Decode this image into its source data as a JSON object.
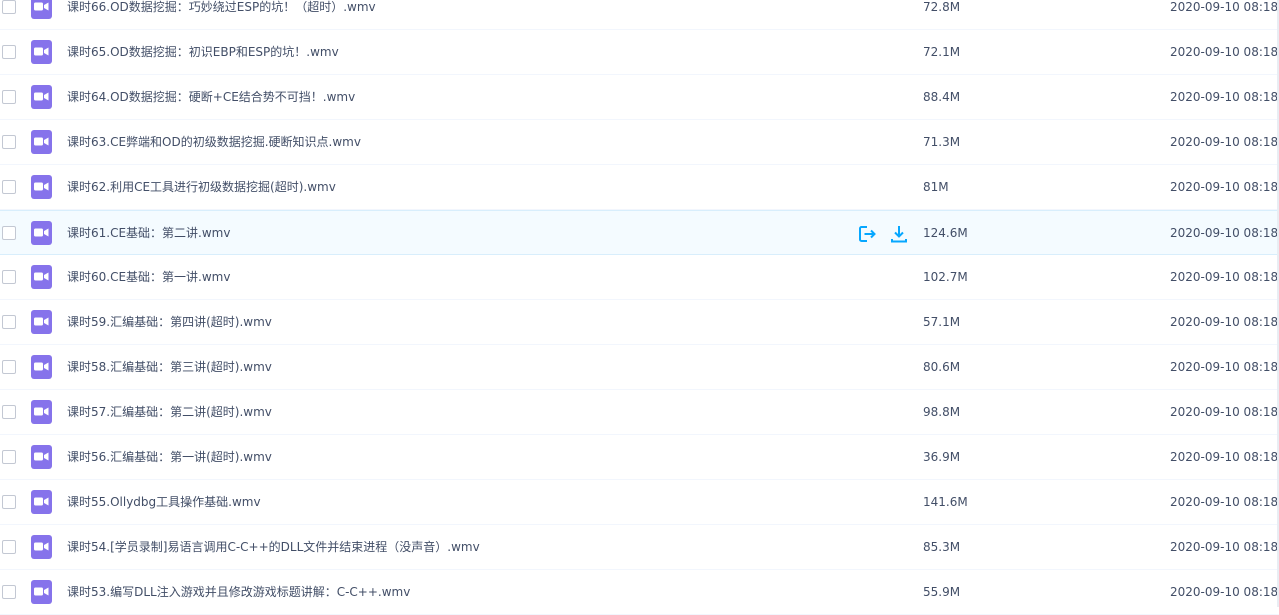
{
  "colors": {
    "accent": "#06a7ff",
    "file_icon": "#8673eb",
    "text": "#424e67",
    "hover_bg": "#f4fbff"
  },
  "actions": {
    "share_icon": "share-icon",
    "download_icon": "download-icon"
  },
  "files": [
    {
      "name": "课时66.OD数据挖掘：巧妙绕过ESP的坑！（超时）.wmv",
      "size": "72.8M",
      "time": "2020-09-10 08:18"
    },
    {
      "name": "课时65.OD数据挖掘：初识EBP和ESP的坑！.wmv",
      "size": "72.1M",
      "time": "2020-09-10 08:18"
    },
    {
      "name": "课时64.OD数据挖掘：硬断+CE结合势不可挡！.wmv",
      "size": "88.4M",
      "time": "2020-09-10 08:18"
    },
    {
      "name": "课时63.CE弊端和OD的初级数据挖掘.硬断知识点.wmv",
      "size": "71.3M",
      "time": "2020-09-10 08:18"
    },
    {
      "name": "课时62.利用CE工具进行初级数据挖掘(超时).wmv",
      "size": "81M",
      "time": "2020-09-10 08:18"
    },
    {
      "name": "课时61.CE基础：第二讲.wmv",
      "size": "124.6M",
      "time": "2020-09-10 08:18"
    },
    {
      "name": "课时60.CE基础：第一讲.wmv",
      "size": "102.7M",
      "time": "2020-09-10 08:18"
    },
    {
      "name": "课时59.汇编基础：第四讲(超时).wmv",
      "size": "57.1M",
      "time": "2020-09-10 08:18"
    },
    {
      "name": "课时58.汇编基础：第三讲(超时).wmv",
      "size": "80.6M",
      "time": "2020-09-10 08:18"
    },
    {
      "name": "课时57.汇编基础：第二讲(超时).wmv",
      "size": "98.8M",
      "time": "2020-09-10 08:18"
    },
    {
      "name": "课时56.汇编基础：第一讲(超时).wmv",
      "size": "36.9M",
      "time": "2020-09-10 08:18"
    },
    {
      "name": "课时55.Ollydbg工具操作基础.wmv",
      "size": "141.6M",
      "time": "2020-09-10 08:18"
    },
    {
      "name": "课时54.[学员录制]易语言调用C-C++的DLL文件并结束进程（没声音）.wmv",
      "size": "85.3M",
      "time": "2020-09-10 08:18"
    },
    {
      "name": "课时53.编写DLL注入游戏并且修改游戏标题讲解：C-C++.wmv",
      "size": "55.9M",
      "time": "2020-09-10 08:18"
    }
  ]
}
